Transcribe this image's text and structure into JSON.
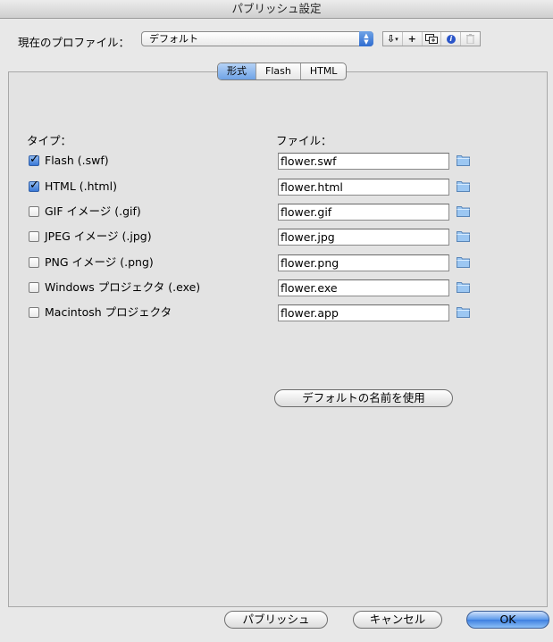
{
  "window": {
    "title": "パブリッシュ設定"
  },
  "profile": {
    "label": "現在のプロファイル：",
    "selected": "デフォルト",
    "tools": [
      "import-export-icon",
      "add-icon",
      "duplicate-icon",
      "info-icon",
      "trash-icon"
    ]
  },
  "tabs": [
    {
      "label": "形式",
      "active": true
    },
    {
      "label": "Flash",
      "active": false
    },
    {
      "label": "HTML",
      "active": false
    }
  ],
  "columns": {
    "type": "タイプ：",
    "file": "ファイル："
  },
  "formats": [
    {
      "label": "Flash  (.swf)",
      "checked": true,
      "file": "flower.swf"
    },
    {
      "label": "HTML (.html)",
      "checked": true,
      "file": "flower.html"
    },
    {
      "label": "GIF イメージ (.gif)",
      "checked": false,
      "file": "flower.gif"
    },
    {
      "label": "JPEG イメージ (.jpg)",
      "checked": false,
      "file": "flower.jpg"
    },
    {
      "label": "PNG イメージ (.png)",
      "checked": false,
      "file": "flower.png"
    },
    {
      "label": "Windows プロジェクタ (.exe)",
      "checked": false,
      "file": "flower.exe"
    },
    {
      "label": "Macintosh プロジェクタ",
      "checked": false,
      "file": "flower.app"
    }
  ],
  "use_default_names": "デフォルトの名前を使用",
  "buttons": {
    "publish": "パブリッシュ",
    "cancel": "キャンセル",
    "ok": "OK"
  },
  "colors": {
    "accent": "#3d7fe0",
    "panel": "#e3e3e3"
  }
}
